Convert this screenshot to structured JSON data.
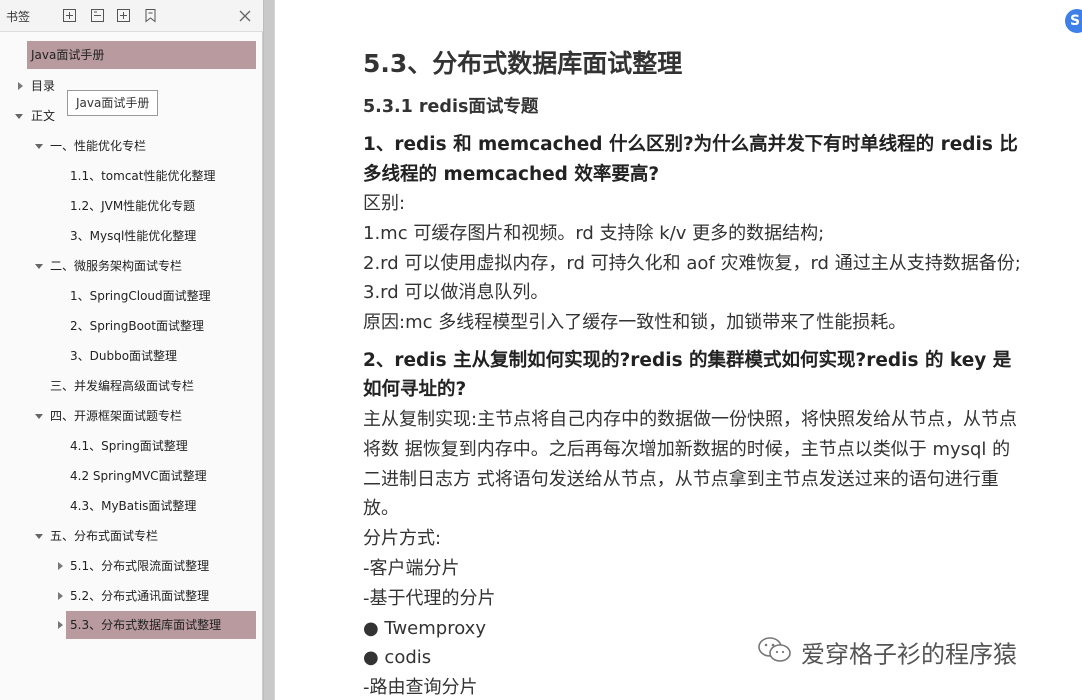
{
  "bookmarks": {
    "title": "书签",
    "tooltip": "Java面试手册",
    "items": [
      {
        "label": "Java面试手册"
      },
      {
        "label": "目录"
      },
      {
        "label": "正文"
      },
      {
        "label": "一、性能优化专栏"
      },
      {
        "label": "1.1、tomcat性能优化整理"
      },
      {
        "label": "1.2、JVM性能优化专题"
      },
      {
        "label": "3、Mysql性能优化整理"
      },
      {
        "label": "二、微服务架构面试专栏"
      },
      {
        "label": "1、SpringCloud面试整理"
      },
      {
        "label": "2、SpringBoot面试整理"
      },
      {
        "label": "3、Dubbo面试整理"
      },
      {
        "label": "三、并发编程高级面试专栏"
      },
      {
        "label": "四、开源框架面试题专栏"
      },
      {
        "label": "4.1、Spring面试整理"
      },
      {
        "label": "4.2 SpringMVC面试整理"
      },
      {
        "label": "4.3、MyBatis面试整理"
      },
      {
        "label": "五、分布式面试专栏"
      },
      {
        "label": "5.1、分布式限流面试整理"
      },
      {
        "label": "5.2、分布式通讯面试整理"
      },
      {
        "label": "5.3、分布式数据库面试整理"
      }
    ]
  },
  "document": {
    "heading": "5.3、分布式数据库面试整理",
    "subheading": "5.3.1 redis面试专题",
    "q1": "1、redis 和 memcached 什么区别?为什么高并发下有时单线程的 redis 比多线程的 memcached 效率要高?",
    "q1_p1": "区别:",
    "q1_p2": "1.mc 可缓存图片和视频。rd 支持除 k/v 更多的数据结构;",
    "q1_p3": "2.rd 可以使用虚拟内存，rd 可持久化和 aof 灾难恢复，rd 通过主从支持数据备份; 3.rd 可以做消息队列。",
    "q1_p4": "原因:mc 多线程模型引入了缓存一致性和锁，加锁带来了性能损耗。",
    "q2": "2、redis 主从复制如何实现的?redis 的集群模式如何实现?redis 的 key 是如何寻址的?",
    "q2_p1": "主从复制实现:主节点将自己内存中的数据做一份快照，将快照发给从节点，从节点将数 据恢复到内存中。之后再每次增加新数据的时候，主节点以类似于 mysql 的二进制日志方 式将语句发送给从节点，从节点拿到主节点发送过来的语句进行重放。",
    "q2_p2": "分片方式:",
    "q2_p3": "-客户端分片",
    "q2_p4": "-基于代理的分片",
    "q2_p5": "● Twemproxy",
    "q2_p6": "● codis",
    "q2_p7": "-路由查询分片"
  },
  "watermark": "爱穿格子衫的程序猿",
  "float_button": "S"
}
